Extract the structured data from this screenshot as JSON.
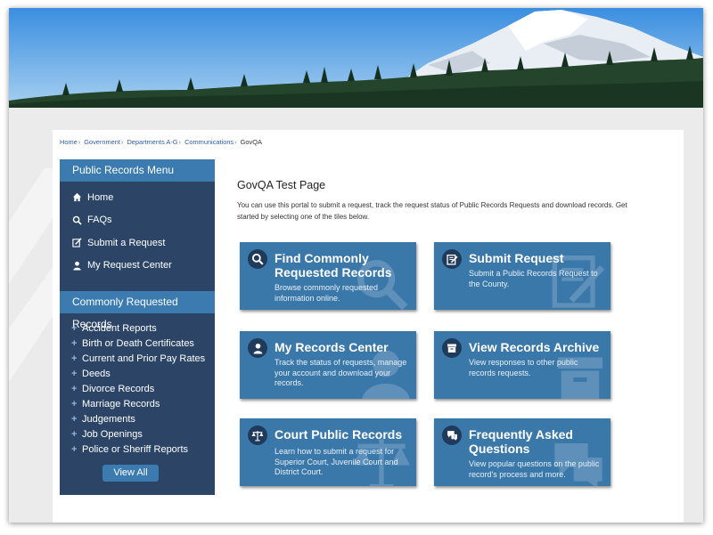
{
  "breadcrumb": {
    "items": [
      "Home",
      "Government",
      "Departments A-G",
      "Communications"
    ],
    "current": "GovQA"
  },
  "sidebar": {
    "menu_title": "Public Records Menu",
    "menu_items": [
      {
        "label": "Home",
        "icon": "home-icon"
      },
      {
        "label": "FAQs",
        "icon": "search-icon"
      },
      {
        "label": "Submit a Request",
        "icon": "edit-icon"
      },
      {
        "label": "My Request Center",
        "icon": "user-icon"
      }
    ],
    "records_title": "Commonly Requested Records",
    "records": [
      "Accident Reports",
      "Birth or Death Certificates",
      "Current and Prior Pay Rates",
      "Deeds",
      "Divorce Records",
      "Marriage Records",
      "Judgements",
      "Job Openings",
      "Police or Sheriff Reports"
    ],
    "view_all_label": "View All"
  },
  "main": {
    "title": "GovQA Test Page",
    "intro": "You can use this portal to submit a request, track the request status of Public Records Requests and download records. Get started by selecting one of the tiles below.",
    "tiles": [
      {
        "title": "Find Commonly Requested Records",
        "desc": "Browse commonly requested information online.",
        "icon": "search-icon"
      },
      {
        "title": "Submit Request",
        "desc": "Submit a Public Records Request to the County.",
        "icon": "form-icon"
      },
      {
        "title": "My Records Center",
        "desc": "Track the status of requests, manage your account and download your records.",
        "icon": "user-icon"
      },
      {
        "title": "View Records Archive",
        "desc": "View responses to other public records requests.",
        "icon": "archive-icon"
      },
      {
        "title": "Court Public Records",
        "desc": "Learn how to submit a request for Superior Court, Juvenile Court and District Court.",
        "icon": "scales-icon"
      },
      {
        "title": "Frequently Asked Questions",
        "desc": "View popular questions on the public record's process and more.",
        "icon": "chat-question-icon"
      }
    ]
  },
  "colors": {
    "sidebar_bg": "#2c4566",
    "accent": "#3b7bb0",
    "tile_bg": "#3b78aa",
    "page_bg": "#ebebeb"
  }
}
